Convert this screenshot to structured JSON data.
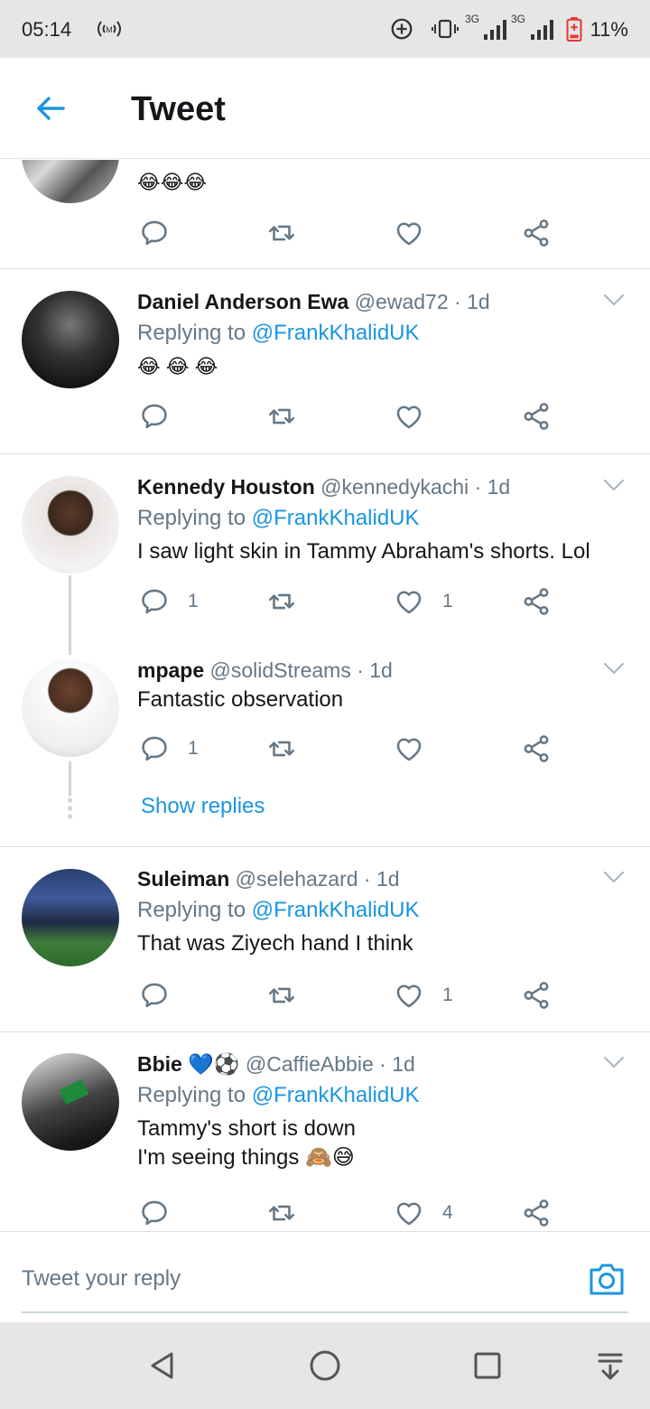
{
  "status_bar": {
    "time": "05:14",
    "network_label": "3G",
    "network_label_2": "3G",
    "battery_percent": "11%"
  },
  "header": {
    "title": "Tweet"
  },
  "tweets": [
    {
      "name": "",
      "handle": "",
      "time": "",
      "replying_to": "",
      "text": "😂😂😂",
      "reply_count": "",
      "retweet_count": "",
      "like_count": ""
    },
    {
      "name": "Daniel Anderson Ewa",
      "handle": "@ewad72",
      "time": "· 1d",
      "replying_prefix": "Replying to",
      "replying_to": "@FrankKhalidUK",
      "text": "😂 😂 😂",
      "reply_count": "",
      "retweet_count": "",
      "like_count": ""
    },
    {
      "name": "Kennedy Houston",
      "handle": "@kennedykachi",
      "time": "· 1d",
      "replying_prefix": "Replying to",
      "replying_to": "@FrankKhalidUK",
      "text": "I saw light skin in Tammy Abraham's shorts. Lol",
      "reply_count": "1",
      "retweet_count": "",
      "like_count": "1"
    },
    {
      "name": "mpape",
      "handle": "@solidStreams",
      "time": "· 1d",
      "text": "Fantastic observation",
      "reply_count": "1",
      "retweet_count": "",
      "like_count": "",
      "show_replies": "Show replies"
    },
    {
      "name": "Suleiman",
      "handle": "@selehazard",
      "time": "· 1d",
      "replying_prefix": "Replying to",
      "replying_to": "@FrankKhalidUK",
      "text": "That was Ziyech hand I think",
      "reply_count": "",
      "retweet_count": "",
      "like_count": "1"
    },
    {
      "name": "Bbie 💙⚽",
      "handle": "@CaffieAbbie",
      "time": "· 1d",
      "replying_prefix": "Replying to",
      "replying_to": "@FrankKhalidUK",
      "text_line1": "Tammy's short is down",
      "text_line2": "I'm seeing things 🙈😅",
      "reply_count": "",
      "retweet_count": "",
      "like_count": "4"
    }
  ],
  "reply_bar": {
    "placeholder": "Tweet your reply"
  },
  "icons": {
    "back": "arrow-left-icon",
    "reply": "reply-bubble-icon",
    "retweet": "retweet-icon",
    "like": "heart-icon",
    "share": "share-icon",
    "more": "chevron-down-icon",
    "camera": "camera-icon",
    "nav_back": "triangle-back-icon",
    "nav_home": "circle-home-icon",
    "nav_recents": "square-recents-icon",
    "nav_notifications": "pull-down-icon"
  },
  "colors": {
    "accent": "#1b95e0",
    "text": "#14171a",
    "muted": "#657786",
    "divider": "#d9dfe3"
  }
}
